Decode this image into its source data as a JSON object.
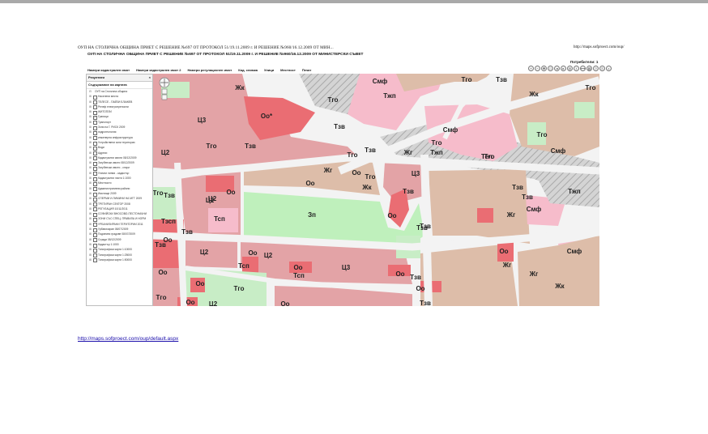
{
  "document": {
    "title": "ОУП НА СТОЛИЧНА ОБЩИНА ПРИЕТ С РЕШЕНИЕ №697 ОТ ПРОТОКОЛ 51/19.11.2009 г. И РЕШЕНИЕ №960/16.12.2009 ОТ МИН...",
    "url": "http://maps.sofproect.com/oup/",
    "link": "http://maps.sofproect.com/oup/default.aspx"
  },
  "app": {
    "title": "ОУП НА СТОЛИЧНА ОБЩИНА ПРИЕТ С РЕШЕНИЕ №697 ОТ ПРОТОКОЛ 51/19.11.2009 г. И РЕШЕНИЕ №960/16.12.2009 ОТ МИНИСТЕРСКИ СЪВЕТ",
    "users_label": "Потребители: 1"
  },
  "menu": [
    "Намери кадастрален имот",
    "Намери кадастрален имот 2",
    "Намери регулационен имот",
    "Кад. снимка",
    "Улици",
    "Местност",
    "Печат"
  ],
  "toolbar": [
    "zoom-in-icon",
    "zoom-out-icon",
    "pan-icon",
    "zoom-box-icon",
    "previous-extent-icon",
    "next-extent-icon",
    "full-extent-icon",
    "identify-icon",
    "measure-icon",
    "print-icon",
    "help-icon",
    "layers-icon",
    "info-icon"
  ],
  "panel": {
    "header": "Резултати",
    "close": "×",
    "subheader": "Съдържание на картата",
    "root": "ОУП на Столична община",
    "layers": [
      {
        "label": "Населени места",
        "checked": false
      },
      {
        "label": "ТЕЛЕСЕ - ПАЙЗИ БЛАЖЕВ",
        "checked": false
      },
      {
        "label": "Релеф електропреносни",
        "checked": false
      },
      {
        "label": "ЖИТОПЛИ",
        "checked": false
      },
      {
        "label": "Граници",
        "checked": true
      },
      {
        "label": "Транспорт",
        "checked": false
      },
      {
        "label": "Зони на Г. РИСК 2009",
        "checked": false
      },
      {
        "label": "хидрогеология",
        "checked": false
      },
      {
        "label": "инженерна инфраструктура",
        "checked": false
      },
      {
        "label": "Устройствени зони територии",
        "checked": false
      },
      {
        "label": "Води",
        "checked": false
      },
      {
        "label": "Адреси",
        "checked": false
      },
      {
        "label": "Кадастрални имоти 08/12/2009",
        "checked": false
      },
      {
        "label": "Загубенски имоти 08/12/2009",
        "checked": false
      },
      {
        "label": "Загубенски имоти - стари",
        "checked": false
      },
      {
        "label": "Улични линии - кадастър",
        "checked": false
      },
      {
        "label": "Кадастрални листи 1:1000",
        "checked": false
      },
      {
        "label": "Местности",
        "checked": false
      },
      {
        "label": "Административни райони",
        "checked": false
      },
      {
        "label": "Имотище 2009",
        "checked": false
      },
      {
        "label": "СПЕРМИ И ЛИМИНИ НА МГТ 2009",
        "checked": false
      },
      {
        "label": "ТРЕТИРАН СЕКТОР 2008",
        "checked": false
      },
      {
        "label": "РЕГУЛАЦИЯ 10/11/2011",
        "checked": false
      },
      {
        "label": "СОФИЙСКИ ВНОСОВО-ПЕСТОНАЧНИ",
        "checked": false
      },
      {
        "label": "ЗОНИ СЪС СПЕЦ. ПРАВИЛА И НОРМ",
        "checked": false
      },
      {
        "label": "УРБАНИЗИРАНИ ТЕРИТОРИИ 2011",
        "checked": false
      },
      {
        "label": "Урбанизиран 08/07/2009",
        "checked": false
      },
      {
        "label": "Подземни градове 08/07/2009",
        "checked": false
      },
      {
        "label": "Сгради 08/12/2009",
        "checked": false
      },
      {
        "label": "Кадастър 1:1000",
        "checked": false
      },
      {
        "label": "Топографски карти 1:10000",
        "checked": false
      },
      {
        "label": "Топографски карти 1:25000",
        "checked": false
      },
      {
        "label": "Топографски карти 1:50000",
        "checked": false
      }
    ]
  },
  "colors": {
    "cz": "#e3a3a6",
    "oo": "#ea6d73",
    "tgo": "#c8edc6",
    "zp": "#bff0bc",
    "smf": "#f6bccb",
    "zhk": "#ddbda9",
    "tzhp": "#d2d2d2",
    "road": "#f3f3f3"
  },
  "map_labels": [
    "Ц3",
    "Оо*",
    "Тго",
    "Тжп",
    "Смф",
    "Жк",
    "Тзв",
    "Тго",
    "Жг",
    "Тго",
    "Тзв",
    "Тго",
    "Тзв",
    "Тго",
    "Жк",
    "Тго",
    "Смф",
    "Тго",
    "Тел",
    "Тжп",
    "Смф",
    "Ц2",
    "Тго",
    "Тзв",
    "Жг",
    "Оо",
    "Тго",
    "Ц3",
    "Оо",
    "Жк",
    "Тго",
    "Тзв",
    "Ц2",
    "Оо",
    "Тзв",
    "Тжп",
    "Тзв",
    "Тзв",
    "Смф",
    "Тзв",
    "Жг",
    "Оо",
    "Ц2",
    "Тсп",
    "Зп",
    "Оо",
    "Тзсп",
    "Тзв",
    "Тзв",
    "Оо",
    "Тзв",
    "Ц2",
    "Тсп",
    "Оо",
    "Жг",
    "Смф",
    "Ц2",
    "Оо",
    "Тсп",
    "Оо",
    "Ц3",
    "Оо",
    "Оо",
    "Тго",
    "Тзв",
    "Жг",
    "Оо",
    "Жк",
    "Тго",
    "Ц2",
    "Оо",
    "Оо",
    "Тзв"
  ]
}
